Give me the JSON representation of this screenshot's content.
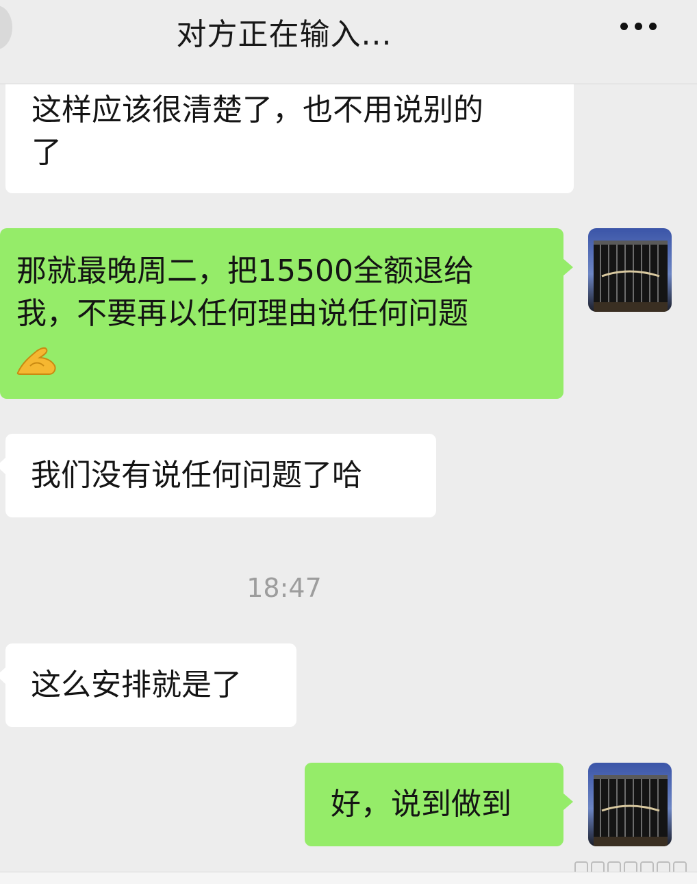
{
  "header": {
    "title": "对方正在输入..."
  },
  "messages": [
    {
      "side": "incoming",
      "lines": [
        "这样应该很清楚了，也不用说别的",
        "了"
      ]
    },
    {
      "side": "outgoing",
      "lines": [
        "那就最晚周二，把15500全额退给",
        "我，不要再以任何理由说任何问题"
      ],
      "emoji": "ok-hand-emoji"
    },
    {
      "side": "incoming",
      "lines": [
        "我们没有说任何问题了哈"
      ]
    },
    {
      "side": "incoming",
      "lines": [
        "这么安排就是了"
      ]
    },
    {
      "side": "outgoing",
      "lines": [
        "好，说到做到"
      ]
    }
  ],
  "timestamp": "18:47",
  "icons": {
    "more": "more-dots-icon",
    "avatar": "avatar-building-photo"
  },
  "colors": {
    "background": "#ededed",
    "incoming_bubble": "#ffffff",
    "outgoing_bubble": "#95ec69",
    "timestamp_text": "#9d9d9d"
  }
}
